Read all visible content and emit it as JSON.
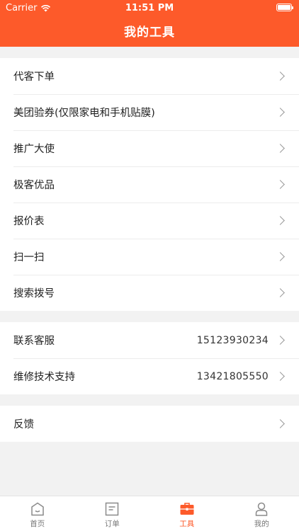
{
  "status_bar": {
    "carrier": "Carrier",
    "time": "11:51 PM"
  },
  "header": {
    "title": "我的工具"
  },
  "groups": [
    {
      "rows": [
        {
          "label": "代客下单"
        },
        {
          "label": "美团验券(仅限家电和手机贴膜)"
        },
        {
          "label": "推广大使"
        },
        {
          "label": "极客优品"
        },
        {
          "label": "报价表"
        },
        {
          "label": "扫一扫"
        },
        {
          "label": "搜索拨号"
        }
      ]
    },
    {
      "rows": [
        {
          "label": "联系客服",
          "value": "15123930234"
        },
        {
          "label": "维修技术支持",
          "value": "13421805550"
        }
      ]
    },
    {
      "rows": [
        {
          "label": "反馈"
        }
      ]
    }
  ],
  "tabbar": {
    "items": [
      {
        "label": "首页",
        "icon": "home-icon"
      },
      {
        "label": "订单",
        "icon": "order-icon"
      },
      {
        "label": "工具",
        "icon": "toolbox-icon",
        "active": true
      },
      {
        "label": "我的",
        "icon": "person-icon"
      }
    ]
  },
  "colors": {
    "accent": "#fd5a2a",
    "background": "#f2f2f2"
  }
}
